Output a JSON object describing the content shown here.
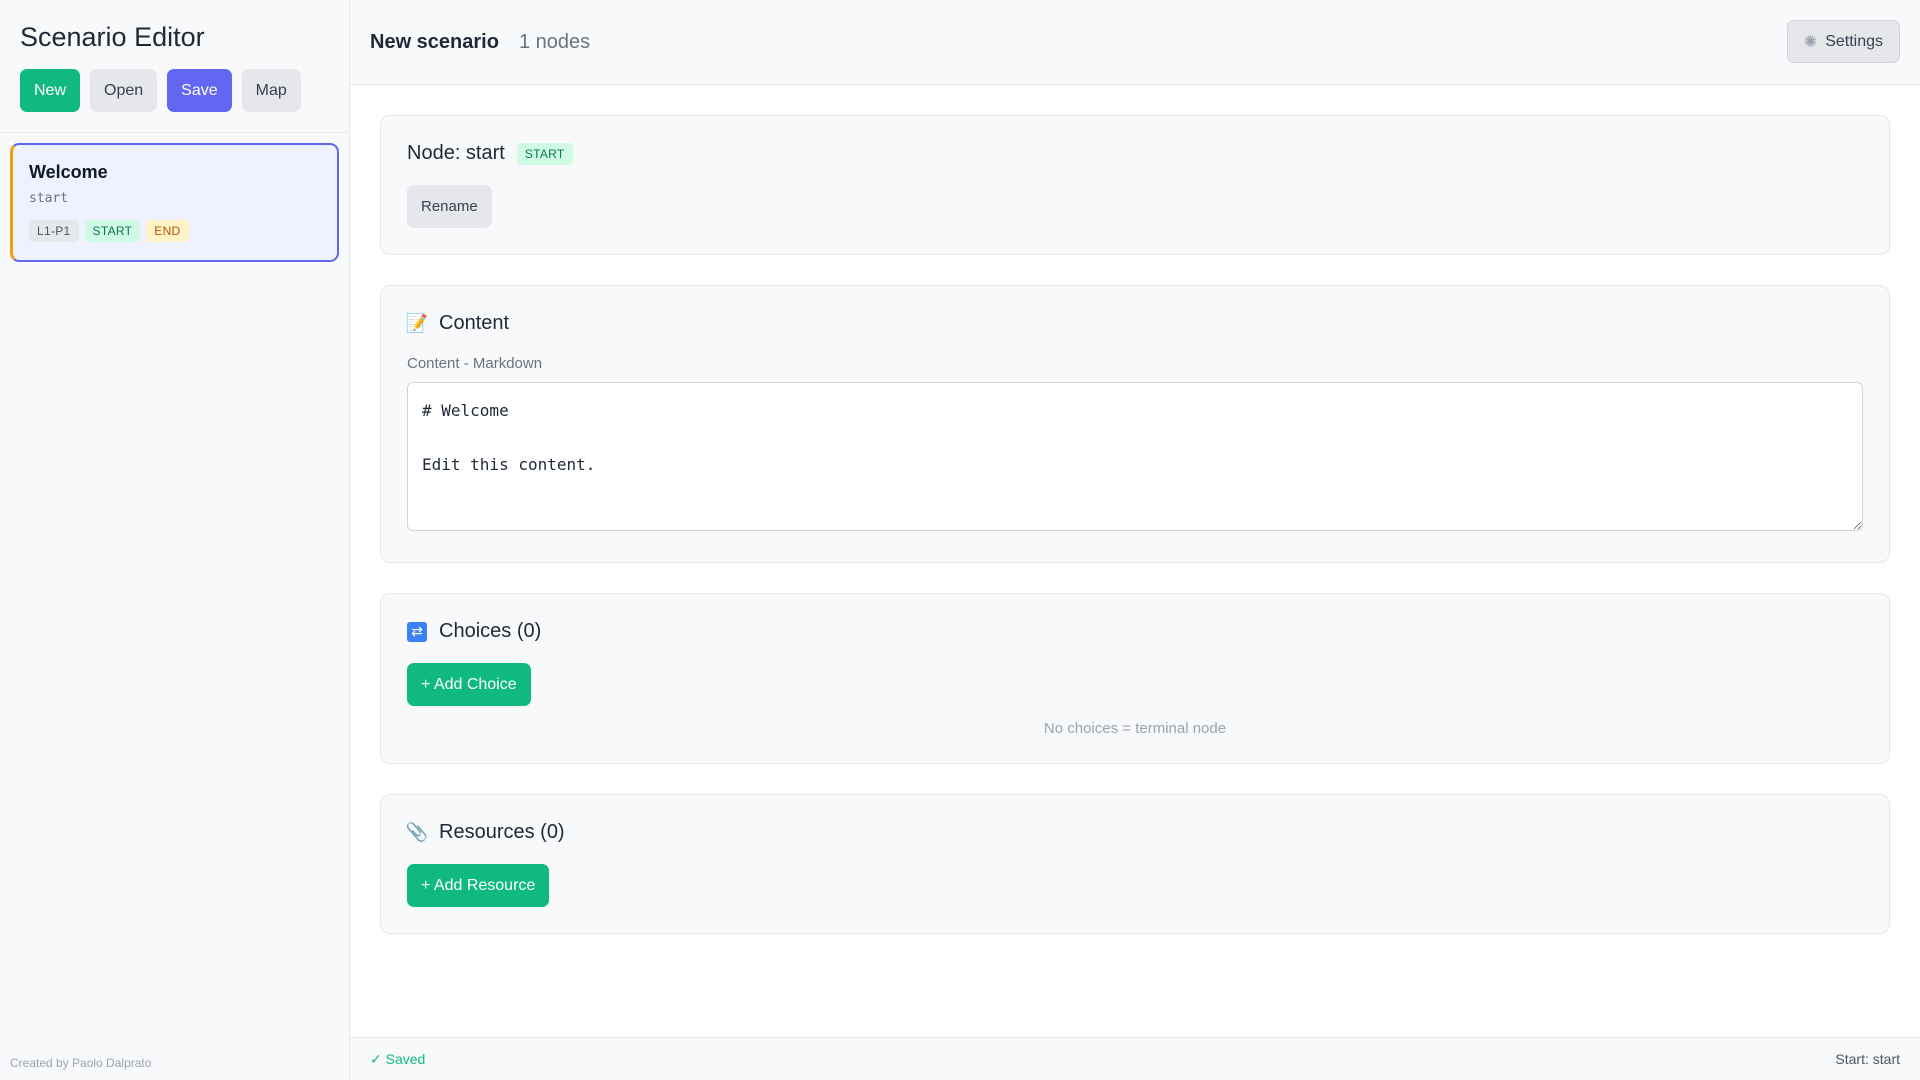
{
  "sidebar": {
    "title": "Scenario Editor",
    "toolbar": {
      "new_label": "New",
      "open_label": "Open",
      "save_label": "Save",
      "map_label": "Map"
    },
    "nodes": [
      {
        "title": "Welcome",
        "id": "start",
        "badges": [
          "L1-P1",
          "START",
          "END"
        ]
      }
    ],
    "footer": "Created by Paolo Dalprato"
  },
  "topbar": {
    "scenario_name": "New scenario",
    "node_count": "1 nodes",
    "settings_label": "Settings",
    "settings_icon": "gear-icon"
  },
  "node_panel": {
    "title": "Node: start",
    "badge": "START",
    "rename_label": "Rename"
  },
  "content_panel": {
    "icon": "memo-icon",
    "title": "Content",
    "field_label": "Content - Markdown",
    "value": "# Welcome\n\nEdit this content."
  },
  "choices_panel": {
    "icon": "shuffle-icon",
    "title": "Choices (0)",
    "add_label": "+ Add Choice",
    "empty_hint": "No choices = terminal node"
  },
  "resources_panel": {
    "icon": "paperclip-icon",
    "title": "Resources (0)",
    "add_label": "+ Add Resource"
  },
  "statusbar": {
    "saved": "✓ Saved",
    "start": "Start: start"
  },
  "colors": {
    "primary_green": "#10b981",
    "primary_indigo": "#6366f1",
    "accent_amber": "#f59e0b"
  }
}
